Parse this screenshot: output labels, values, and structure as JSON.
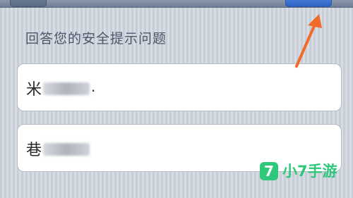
{
  "security_question": {
    "title": "回答您的安全提示问题",
    "answers": [
      {
        "prefix": "米",
        "suffix": "."
      },
      {
        "prefix": "巷",
        "suffix": ""
      }
    ]
  },
  "watermark": {
    "logo_char": "7",
    "text": "小7手游"
  },
  "colors": {
    "arrow": "#f06a2a",
    "watermark": "#2fc77a",
    "done_button": "#3b75d6"
  }
}
